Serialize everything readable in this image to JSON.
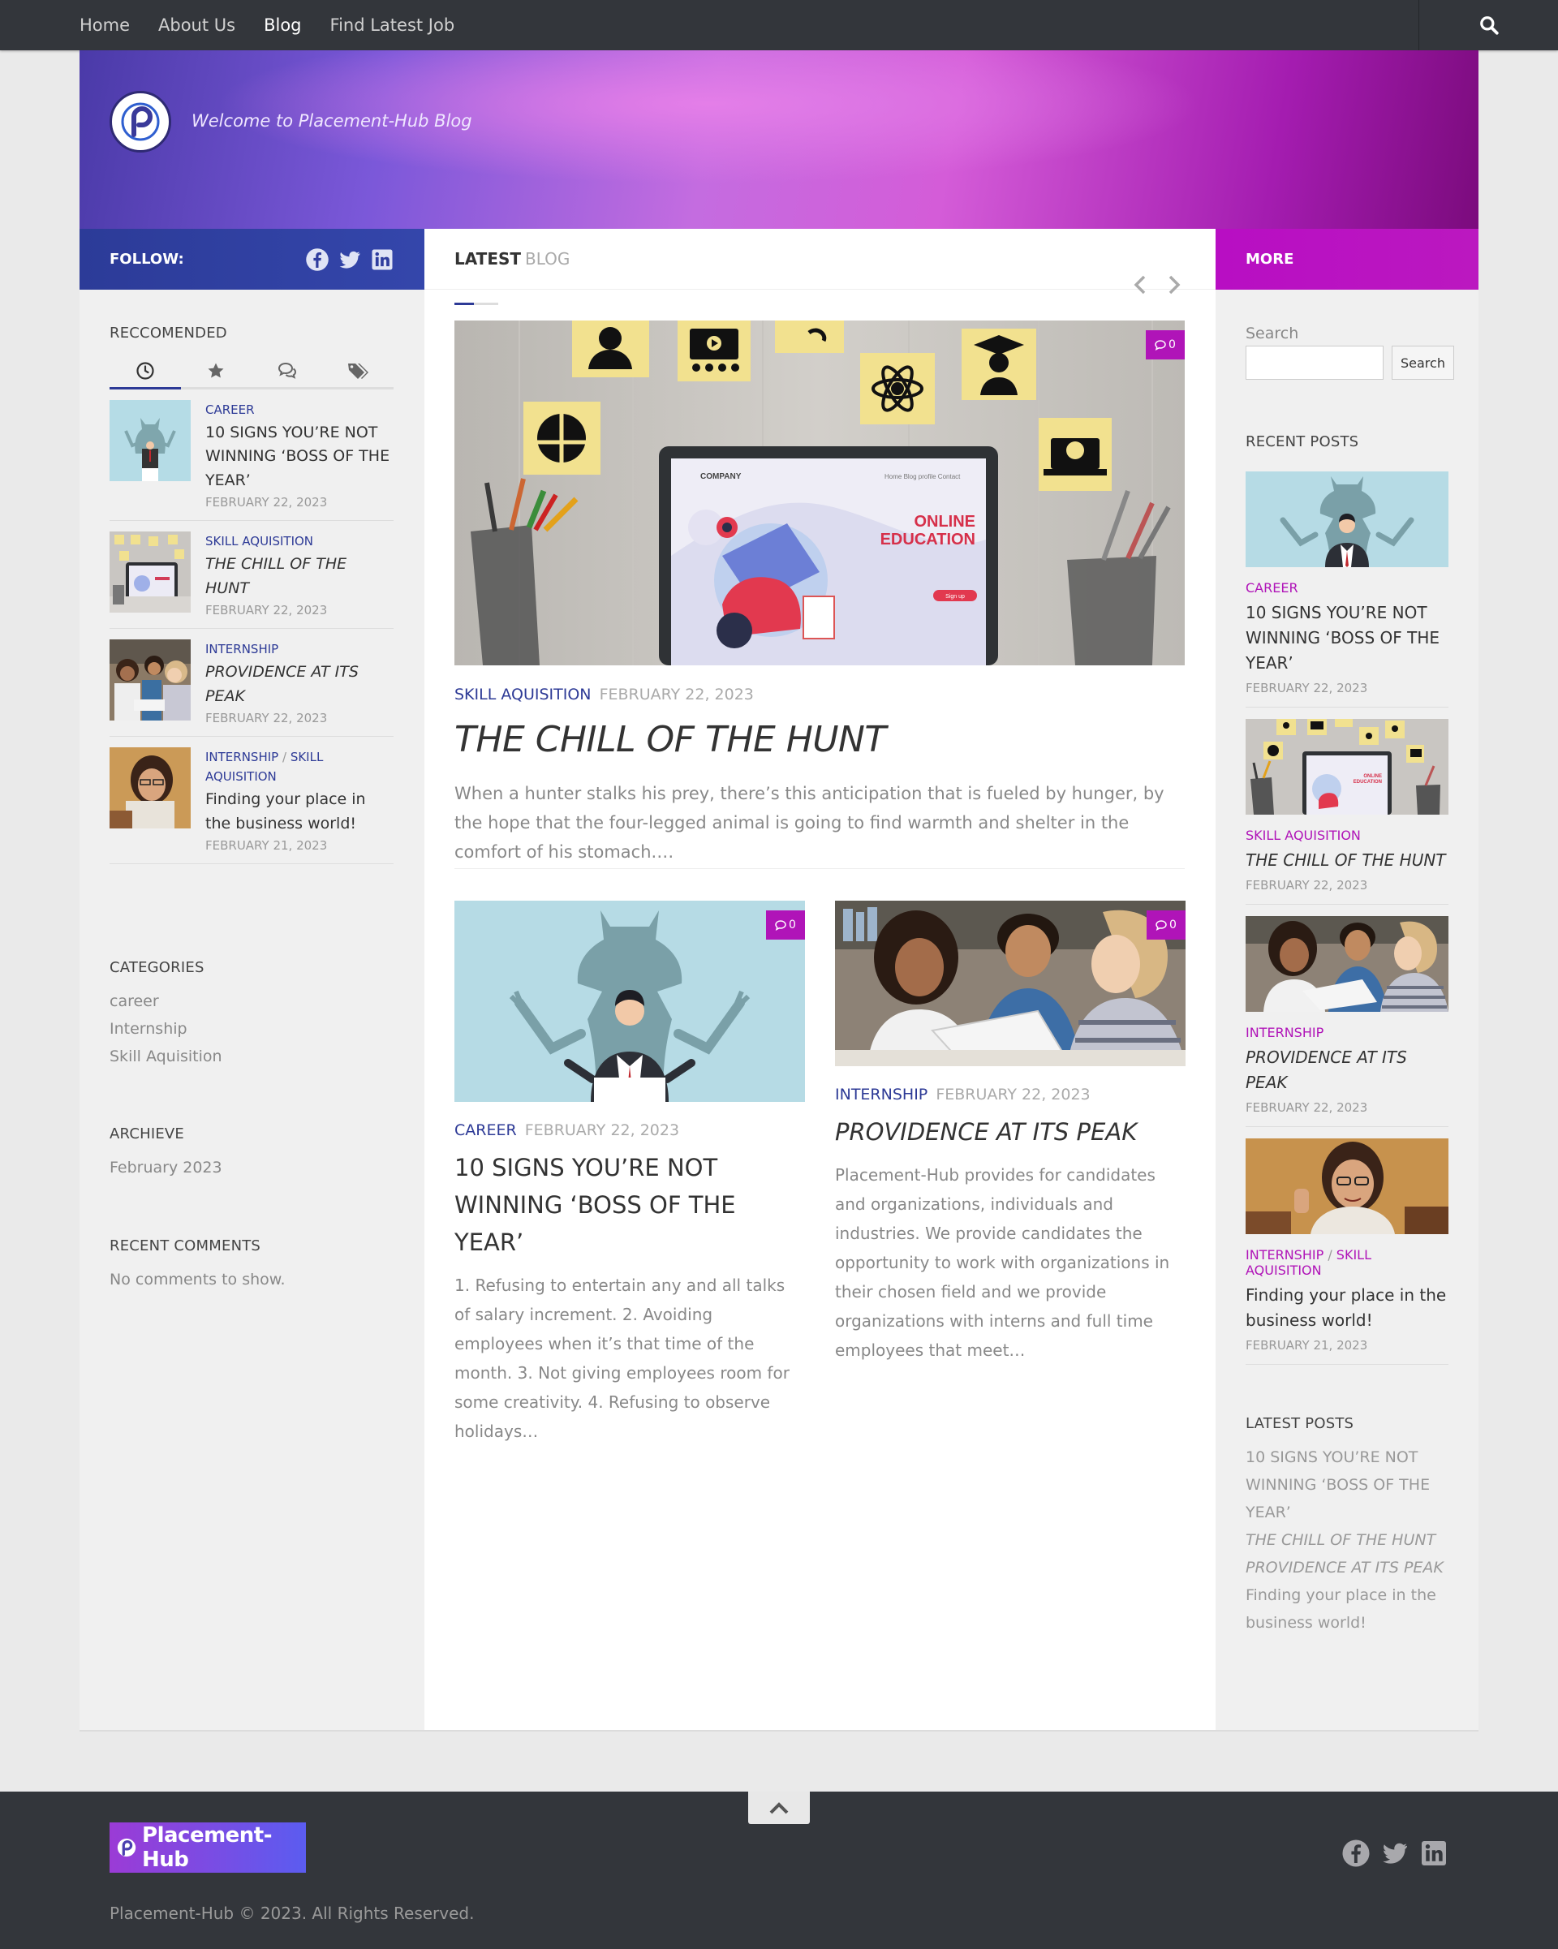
{
  "nav": {
    "items": [
      {
        "label": "Home"
      },
      {
        "label": "About Us"
      },
      {
        "label": "Blog"
      },
      {
        "label": "Find Latest Job"
      }
    ]
  },
  "header": {
    "tagline": "Welcome to Placement-Hub Blog"
  },
  "left": {
    "follow_label": "FOLLOW:",
    "recommended_title": "RECCOMENDED",
    "recommended": [
      {
        "cats": [
          "CAREER"
        ],
        "title": "10 SIGNS YOU’RE NOT WINNING ‘BOSS OF THE YEAR’",
        "date": "FEBRUARY 22, 2023"
      },
      {
        "cats": [
          "SKILL AQUISITION"
        ],
        "title": "THE CHILL OF THE HUNT",
        "date": "FEBRUARY 22, 2023"
      },
      {
        "cats": [
          "INTERNSHIP"
        ],
        "title": "PROVIDENCE AT ITS PEAK",
        "date": "FEBRUARY 22, 2023"
      },
      {
        "cats": [
          "INTERNSHIP",
          "SKILL AQUISITION"
        ],
        "sep": "/",
        "title": "Finding your place in the business world!",
        "date": "FEBRUARY 21, 2023"
      }
    ],
    "categories_title": "CATEGORIES",
    "categories": [
      "career",
      "Internship",
      "Skill Aquisition"
    ],
    "archive_title": "ARCHIEVE",
    "archive": [
      "February 2023"
    ],
    "comments_title": "RECENT COMMENTS",
    "comments_empty": "No comments to show."
  },
  "center": {
    "head_bold": "LATEST",
    "head_light": "BLOG",
    "featured": {
      "comments": "0",
      "cat": "SKILL AQUISITION",
      "date": "FEBRUARY 22, 2023",
      "title": "THE CHILL OF THE HUNT",
      "excerpt": "When a hunter stalks his prey, there’s this anticipation that is fueled by hunger, by the hope that the four-legged animal is going to find warmth and shelter in the comfort of his stomach.…",
      "screen_brand": "COMPANY",
      "screen_nav": "Home   Blog   profile   Contact",
      "screen_title_1": "ONLINE",
      "screen_title_2": "EDUCATION",
      "screen_button": "Sign up"
    },
    "cards": [
      {
        "comments": "0",
        "cat": "CAREER",
        "date": "FEBRUARY 22, 2023",
        "title": "10 SIGNS YOU’RE NOT WINNING ‘BOSS OF THE YEAR’",
        "excerpt": "1. Refusing to entertain any and all talks of salary increment.  2. Avoiding employees when it’s that time of the month. 3. Not giving employees room for some creativity. 4. Refusing to observe holidays…"
      },
      {
        "comments": "0",
        "cat": "INTERNSHIP",
        "date": "FEBRUARY 22, 2023",
        "title": "PROVIDENCE AT ITS PEAK",
        "excerpt": "Placement-Hub provides for candidates and organizations, individuals and industries. We provide candidates the opportunity to work with organizations in their chosen field and we provide organizations with interns and full time employees that meet…"
      }
    ]
  },
  "right": {
    "more_label": "MORE",
    "search_label": "Search",
    "search_button": "Search",
    "recent_title": "RECENT POSTS",
    "recent": [
      {
        "cats": [
          "CAREER"
        ],
        "title": "10 SIGNS YOU’RE NOT WINNING ‘BOSS OF THE YEAR’",
        "date": "FEBRUARY 22, 2023"
      },
      {
        "cats": [
          "SKILL AQUISITION"
        ],
        "title": "THE CHILL OF THE HUNT",
        "date": "FEBRUARY 22, 2023"
      },
      {
        "cats": [
          "INTERNSHIP"
        ],
        "title": "PROVIDENCE AT ITS PEAK",
        "date": "FEBRUARY 22, 2023"
      },
      {
        "cats": [
          "INTERNSHIP",
          "SKILL AQUISITION"
        ],
        "sep": "/",
        "title": "Finding your place in the business world!",
        "date": "FEBRUARY 21, 2023"
      }
    ],
    "latest_title": "LATEST POSTS",
    "latest": [
      "10 SIGNS YOU’RE NOT WINNING ‘BOSS OF THE YEAR’",
      "THE CHILL OF THE HUNT",
      "PROVIDENCE AT ITS PEAK",
      "Finding your place in the business world!"
    ]
  },
  "footer": {
    "logo_text": "Placement-Hub",
    "copyright": "Placement-Hub © 2023. All Rights Reserved."
  },
  "colors": {
    "accent_blue": "#2d3a96",
    "accent_magenta": "#b014b8",
    "dark_bar": "#33363b"
  },
  "icons": [
    "search-icon",
    "facebook-icon",
    "twitter-icon",
    "linkedin-icon",
    "clock-icon",
    "star-icon",
    "comments-icon",
    "tags-icon",
    "chevron-left-icon",
    "chevron-right-icon",
    "chevron-up-icon",
    "comment-icon"
  ]
}
